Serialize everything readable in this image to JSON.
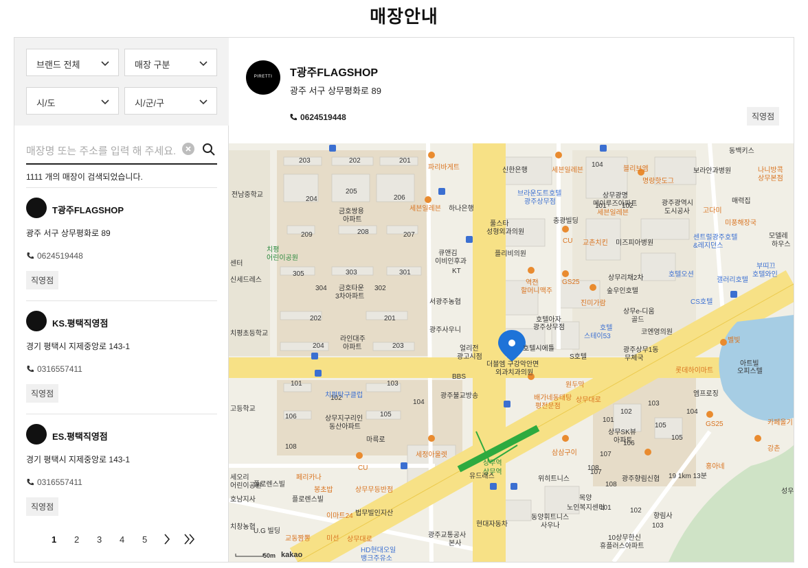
{
  "page": {
    "title": "매장안내"
  },
  "filters": {
    "brand": "브랜드 전체",
    "type": "매장 구분",
    "city": "시/도",
    "district": "시/군/구"
  },
  "search": {
    "placeholder": "매장명 또는 주소를 입력 해 주세요.",
    "result_count": "1111 개의 매장이 검색되었습니다."
  },
  "stores": [
    {
      "name": "T광주FLAGSHOP",
      "address": "광주 서구 상무평화로 89",
      "phone": "0624519448",
      "badge": "직영점"
    },
    {
      "name": "KS.평택직영점",
      "address": "경기 평택시 지제중앙로 143-1",
      "phone": "0316557411",
      "badge": "직영점"
    },
    {
      "name": "ES.평택직영점",
      "address": "경기 평택시 지제중앙로 143-1",
      "phone": "0316557411",
      "badge": "직영점"
    }
  ],
  "pagination": {
    "pages": [
      "1",
      "2",
      "3",
      "4",
      "5"
    ],
    "current": "1",
    "next": "›",
    "last": "»"
  },
  "detail": {
    "logo_text": "PIRETTI",
    "name": "T광주FLAGSHOP",
    "address": "광주 서구 상무평화로 89",
    "phone": "0624519448",
    "badge": "직영점"
  },
  "map": {
    "attribution": "kakao",
    "scale": "50m",
    "labels": {
      "a1": "203",
      "a2": "202",
      "a3": "201",
      "a4": "204",
      "a5": "205",
      "a6": "206",
      "a7": "금호쌍용",
      "a8": "아파트",
      "a9": "209",
      "a10": "208",
      "a11": "207",
      "a12": "305",
      "a13": "303",
      "a14": "301",
      "a15": "304",
      "a16": "302",
      "a17": "금호타운",
      "a18": "3차아파트",
      "a19": "202",
      "a20": "201",
      "a21": "라인대주",
      "a22": "아파트",
      "a23": "204",
      "a24": "203",
      "a25": "101",
      "a26": "103",
      "a27": "102",
      "a28": "104",
      "a29": "106",
      "a30": "105",
      "a31": "108",
      "b1": "파리바게트",
      "b2": "신한은행",
      "b3": "세븐일레븐",
      "b4": "하나은행",
      "b5": "세븐일레븐",
      "b6": "풀스타",
      "b7": "성형외과의원",
      "b8": "큐앤김",
      "b9": "이비인후과",
      "b10": "KT",
      "b11": "플리비의원",
      "b12": "서광주농협",
      "b13": "광주사우니",
      "b14": "얼리전",
      "b15": "광고시점",
      "b16": "BBS",
      "b17": "광주불교방송",
      "b18": "더블엠 구강악안면",
      "b19": "외과치과의원",
      "b20": "호텔시에틀",
      "b21": "호텔아자",
      "b22": "광주상무점",
      "b23": "S호텔",
      "b24": "역전",
      "b25": "할머니맥주",
      "b26": "GS25",
      "b27": "진미가람",
      "b28": "호텔",
      "b29": "스테이53",
      "b30": "브라운도트호텔",
      "b31": "광주상무점",
      "b32": "충광빌딩",
      "b33": "CU",
      "b34": "교촌치킨",
      "b35": "미즈피아병원",
      "b36": "상무광명",
      "b37": "메이루즈아파트",
      "b38": "세븐일레븐",
      "b39": "104",
      "b40": "101",
      "b41": "102",
      "b42": "블리브엠",
      "b43": "명랑핫도그",
      "b44": "보라안과병원",
      "b45": "광주광역시",
      "b46": "도시공사",
      "b47": "고다미",
      "b48": "매력집",
      "b49": "센트럴광주호텔",
      "b50": "&레지던스",
      "b51": "미풍해장국",
      "b52": "상무리채2차",
      "b53": "숲우인호텔",
      "b54": "상무e-디움",
      "b55": "골드",
      "b56": "호텔오션",
      "b57": "갤러리호텔",
      "b58": "CS호텔",
      "b59": "코엔영의원",
      "b60": "광주상무1동",
      "b61": "무체국",
      "b62": "롯데하이마트",
      "b63": "벨빛",
      "b64": "아트빌",
      "b65": "오피스텔",
      "b66": "원두막",
      "b67": "배가네동태탕",
      "b68": "평전문점",
      "b69": "엠프로징",
      "b70": "동백키스",
      "b71": "나니방콕",
      "b72": "상무본점",
      "b73": "모델레",
      "b74": "하우스",
      "b75": "부띠끄",
      "b76": "호텔와인",
      "c1": "전남중학교",
      "c2": "치평",
      "c3": "어린이공원",
      "c4": "센터",
      "c5": "치평초등학교",
      "c6": "치평탁구클럽",
      "c7": "상무지구리인",
      "c8": "동산아파트",
      "c9": "마륵로",
      "c10": "세정아울렛",
      "c11": "CU",
      "c12": "상무역",
      "c13": "위히트니스",
      "c14": "삼삼구이",
      "c15": "상무SK뷰",
      "c16": "아파트",
      "c17": "광주향림신협",
      "c18": "향림사",
      "c19": "노인복지센터",
      "c20": "동양휘트니스",
      "c21": "사우나",
      "c22": "광주교통공사",
      "c23": "본사",
      "c24": "현대자동차",
      "c25": "HD현대오일",
      "c26": "뱅크주유소",
      "c27": "상무대로",
      "c28": "법무빌인지산",
      "c29": "이마트24",
      "c30": "교동짬뽕",
      "c31": "미선",
      "c32": "U.G 빌딩",
      "c33": "치창농협",
      "c34": "호남지사",
      "c35": "플로렌스빌",
      "c36": "페리카나",
      "c37": "봉초밥",
      "c38": "상무무등반점",
      "c39": "플로렌스빌",
      "c40": "세오리",
      "c41": "어린이공원",
      "c42": "고등학교",
      "c43": "카페올기",
      "c44": "강촌",
      "c45": "홍아네",
      "c46": "10상무한신",
      "c47": "휴플러스아파트",
      "c48": "103",
      "c49": "102",
      "c50": "101",
      "c51": "107",
      "c52": "108",
      "c53": "105",
      "c54": "106",
      "c55": "상무대로",
      "c56": "GS25",
      "c57": "104",
      "c58": "103",
      "c59": "102",
      "c60": "101",
      "c61": "105",
      "c62": "108",
      "c63": "107",
      "c64": "성우",
      "c65": "19 1km 13분",
      "c66": "목양",
      "c67": "상무역",
      "c68": "신세드레스",
      "c69": "유드래스"
    }
  },
  "colors": {
    "accent": "#111111",
    "pin": "#1e73d8",
    "road_major": "#f6d55c",
    "subway": "#2eaa3f"
  }
}
